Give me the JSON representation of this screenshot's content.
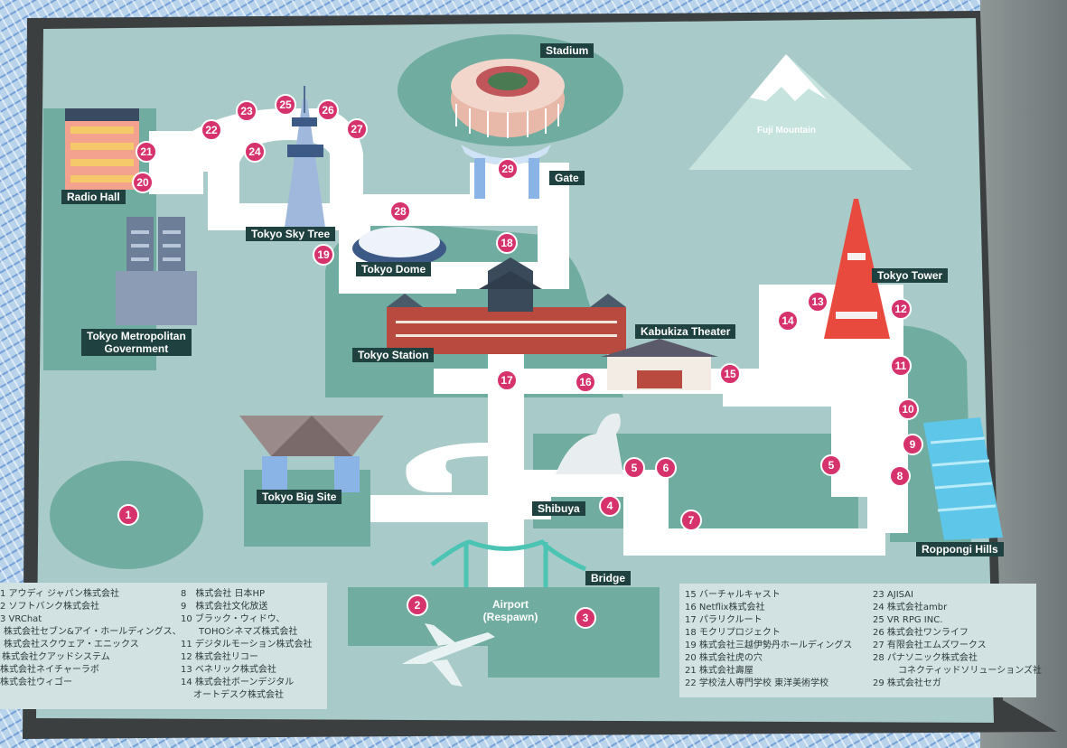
{
  "labels": {
    "stadium": "Stadium",
    "gate": "Gate",
    "fuji": "Fuji Mountain",
    "radio_hall": "Radio Hall",
    "sky_tree": "Tokyo Sky Tree",
    "tokyo_dome": "Tokyo Dome",
    "metropolitan_1": "Tokyo Metropolitan",
    "metropolitan_2": "Government",
    "tokyo_station": "Tokyo Station",
    "kabukiza": "Kabukiza Theater",
    "tokyo_tower": "Tokyo Tower",
    "big_site": "Tokyo Big Site",
    "shibuya": "Shibuya",
    "roppongi": "Roppongi Hills",
    "bridge": "Bridge",
    "airport_1": "Airport",
    "airport_2": "(Respawn)"
  },
  "markers": [
    "1",
    "2",
    "3",
    "4",
    "5",
    "6",
    "7",
    "8",
    "9",
    "10",
    "11",
    "12",
    "13",
    "14",
    "15",
    "16",
    "17",
    "18",
    "19",
    "20",
    "21",
    "22",
    "23",
    "24",
    "25",
    "26",
    "27",
    "28",
    "29"
  ],
  "legend_left": [
    "1 アウディ ジャパン株式会社",
    "2 ソフトバンク株式会社",
    "3 VRChat",
    "株式会社セブン&アイ・ホールディングス、",
    "株式会社スクウェア・エニックス",
    "株式会社クアッドシステム",
    "株式会社ネイチャーラボ",
    "株式会社ウィゴー"
  ],
  "legend_mid": [
    "8　株式会社 日本HP",
    "9　株式会社文化放送",
    "10 ブラック・ウィドウ、",
    "TOHOシネマズ株式会社",
    "11 デジタルモーション株式会社",
    "12 株式会社リコー",
    "13 ベネリック株式会社",
    "14 株式会社ボーンデジタル",
    "オートデスク株式会社"
  ],
  "legend_right_a": [
    "15 バーチャルキャスト",
    "16 Netflix株式会社",
    "17 パラリクルート",
    "18 モクリプロジェクト",
    "19 株式会社三越伊勢丹ホールディングス",
    "20 株式会社虎の穴",
    "21 株式会社壽屋",
    "22 学校法人専門学校 東洋美術学校"
  ],
  "legend_right_b": [
    "23 AJISAI",
    "24 株式会社ambr",
    "25 VR RPG INC.",
    "26 株式会社ワンライフ",
    "27 有限会社エムズワークス",
    "28 パナソニック株式会社",
    "コネクティッドソリューションズ社",
    "29 株式会社セガ"
  ],
  "colors": {
    "map": "#a8cac8",
    "green": "#70aca0",
    "road": "#ffffff",
    "marker": "#d6336c",
    "label": "#1f4241"
  }
}
